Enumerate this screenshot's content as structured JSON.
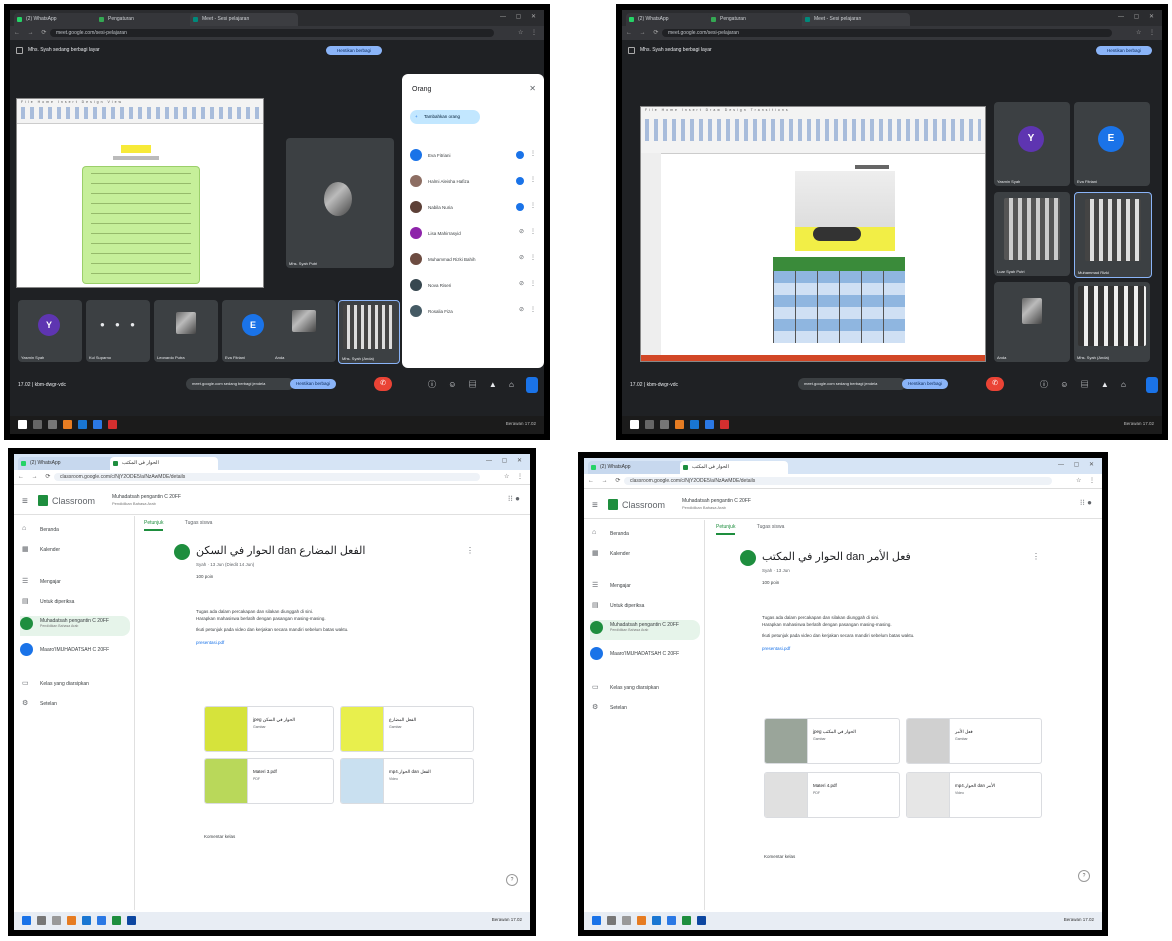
{
  "colors": {
    "meet_bg": "#1f2124",
    "accent_blue": "#8ab4f8",
    "end_call": "#ea4335",
    "classroom_green": "#1e8e3e"
  },
  "meet_common": {
    "tab1": "(2) WhatsApp",
    "tab2": "Pengaturan",
    "tab3": "Meet - Sesi pelajaran",
    "url": "meet.google.com/sesi-pelajaran",
    "banner": "Mhs. Syah sedang berbagi layar",
    "present_btn": "Hentikan berbagi",
    "stop_label": "Hentikan berbagi",
    "present_chip": "meet.google.com sedang berbagi jendela",
    "clock": "17.02 | kbm-dwgr-vdc",
    "tray": "Berawan  17.02"
  },
  "meet1": {
    "people_title": "Orang",
    "add_people": "Tambahkan orang",
    "presenter_name": "Mhs. Syah Putri",
    "people": [
      {
        "name": "Eva Fitriani",
        "color": "#1a73e8"
      },
      {
        "name": "Halmi Aleisha Hafiza",
        "color": "#8d6e63"
      },
      {
        "name": "Nabila Nuria",
        "color": "#5d4037"
      },
      {
        "name": "Lisa Mahirrasyid",
        "color": "#8e24aa"
      },
      {
        "name": "Muhammad Rizki Bahih",
        "color": "#6d4c41"
      },
      {
        "name": "Nova Riseri",
        "color": "#37474f"
      },
      {
        "name": "Rosalia Fiza",
        "color": "#455a64"
      }
    ],
    "tiles": [
      {
        "name": "Yasmin Syah",
        "letter": "Y",
        "color": "#5e35b1"
      },
      {
        "name": "Kul Suparno",
        "letter": "",
        "color": ""
      },
      {
        "name": "Leonardo Putra",
        "letter": "",
        "color": ""
      },
      {
        "name": "Eva Fitriani",
        "letter": "E",
        "color": "#1a73e8"
      },
      {
        "name": "Anda",
        "letter": "",
        "color": ""
      },
      {
        "name": "Mhs. Syah (Anda)",
        "letter": "",
        "color": ""
      }
    ]
  },
  "meet2": {
    "tiles": [
      {
        "name": "Yasmin Syah",
        "letter": "Y",
        "color": "#5e35b1"
      },
      {
        "name": "Eva Fitriani",
        "letter": "E",
        "color": "#1a73e8"
      },
      {
        "name": "Luar Syah Putri",
        "letter": "",
        "color": ""
      },
      {
        "name": "Muhammad Rizki",
        "letter": "",
        "color": ""
      },
      {
        "name": "Anda",
        "letter": "",
        "color": ""
      },
      {
        "name": "Mhs. Syah (Anda)",
        "letter": "",
        "color": ""
      }
    ]
  },
  "classroom_common": {
    "tab1": "(2) WhatsApp",
    "tab2": "الحوار في المكتب",
    "url": "classroom.google.com/c/NjY2ODE5/a/NzAwMDE/details",
    "brand": "Classroom",
    "course": "Muhadatsah pengantin C 20FF",
    "course_sub": "Pendidikan Bahasa Arab",
    "nav": [
      {
        "icon": "⌂",
        "label": "Beranda"
      },
      {
        "icon": "▦",
        "label": "Kalender"
      },
      {
        "icon": "☰",
        "label": "Mengajar"
      },
      {
        "icon": "▤",
        "label": "Untuk diperiksa"
      },
      {
        "icon": "M",
        "label": "Muhadatsah pengantin C 20FF",
        "sub": "Pendidikan Bahasa Arab",
        "color": "#1e8e3e",
        "selected": true
      },
      {
        "icon": "M",
        "label": "Maaro'IMUHADATSAH C 20FF",
        "color": "#1a73e8"
      },
      {
        "icon": "▭",
        "label": "Kelas yang diarsipkan"
      },
      {
        "icon": "⚙",
        "label": "Setelan"
      }
    ],
    "tab_instructions": "Petunjuk",
    "tab_student_work": "Tugas siswa",
    "points": "100 poin",
    "body_line1": "Tugas ada dalam percakapan dan silakan diunggah di sini.",
    "body_line2": "Harapkan mahasiswa berlatih dengan pasangan masing-masing.",
    "body_line3": "Ikuti petunjuk pada video dan kerjakan secara mandiri sebelum batas waktu.",
    "body_link": "presentasi.pdf",
    "class_comment": "Komentar kelas"
  },
  "classroom1": {
    "title": "الحوار في السكن dan الفعل المضارع",
    "meta": "Syah · 13 Jun  (Diedit 14 Jun)",
    "attachments": [
      {
        "name": "jpeg الحوار في السكن",
        "type": "Gambar",
        "thumb": "#d6e33b"
      },
      {
        "name": "الفعل المضارع",
        "type": "Gambar",
        "thumb": "#e8ef4d"
      },
      {
        "name": "Materi 3.pdf",
        "type": "PDF",
        "thumb": "#b9d85a"
      },
      {
        "name": "mp4.الحوار dan الفعل",
        "type": "Video",
        "thumb": "#c9e0f0"
      }
    ]
  },
  "classroom2": {
    "title": "الحوار في المكتب dan فعل الأمر",
    "meta": "Syah · 13 Jun",
    "attachments": [
      {
        "name": "jpeg الحوار في المكتب",
        "type": "Gambar",
        "thumb": "#9aa59a"
      },
      {
        "name": "فعل الأمر",
        "type": "Gambar",
        "thumb": "#d0d0d0"
      },
      {
        "name": "Materi 4.pdf",
        "type": "PDF",
        "thumb": "#e0e0e0"
      },
      {
        "name": "mp4.الحوار dan الأمر",
        "type": "Video",
        "thumb": "#e6e6e6"
      }
    ]
  }
}
